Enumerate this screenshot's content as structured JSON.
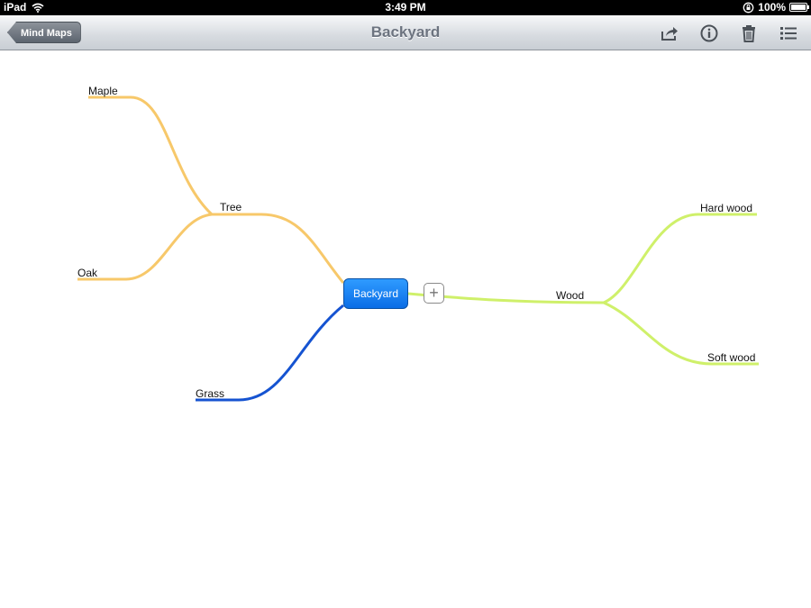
{
  "status_bar": {
    "device": "iPad",
    "time": "3:49 PM",
    "battery": "100%"
  },
  "nav": {
    "back_label": "Mind Maps",
    "title": "Backyard",
    "icons": [
      "share-icon",
      "info-icon",
      "trash-icon",
      "list-icon"
    ]
  },
  "mindmap": {
    "root": "Backyard",
    "add_symbol": "+",
    "branches": [
      {
        "label": "Tree",
        "color": "#f7c86a",
        "children": [
          "Maple",
          "Oak"
        ]
      },
      {
        "label": "Grass",
        "color": "#1553d1",
        "children": []
      },
      {
        "label": "Wood",
        "color": "#cff06a",
        "children": [
          "Hard wood",
          "Soft wood"
        ]
      }
    ]
  }
}
